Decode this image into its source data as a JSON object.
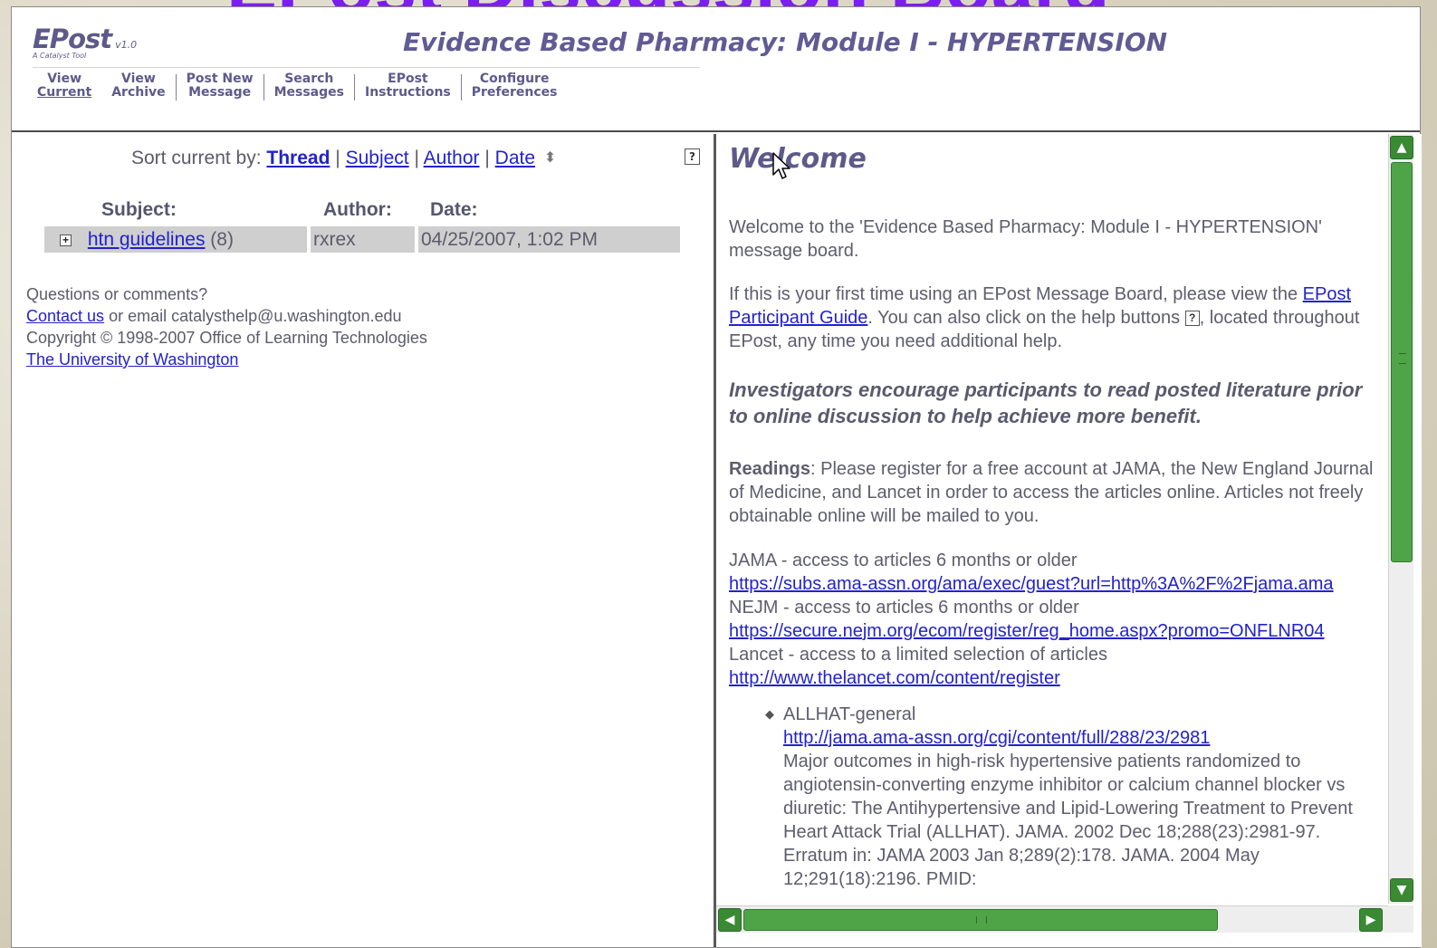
{
  "slide": {
    "title": "EPost Discussion Board",
    "title_color": "#7a1ff0"
  },
  "app": {
    "logo_name": "EPost",
    "logo_version": "v1.0",
    "logo_tagline": "A Catalyst Tool",
    "board_title": "Evidence Based Pharmacy: Module I - HYPERTENSION",
    "accent_color": "#5d5a8a"
  },
  "nav": {
    "items": [
      {
        "line1": "View",
        "line2": "Current",
        "active": true
      },
      {
        "line1": "View",
        "line2": "Archive"
      },
      {
        "line1": "Post New",
        "line2": "Message"
      },
      {
        "line1": "Search",
        "line2": "Messages"
      },
      {
        "line1": "EPost",
        "line2": "Instructions"
      },
      {
        "line1": "Configure",
        "line2": "Preferences"
      }
    ]
  },
  "sort": {
    "prefix": "Sort current by:",
    "options": [
      "Thread",
      "Subject",
      "Author",
      "Date"
    ],
    "selected": "Thread",
    "sep": "|",
    "help_label": "?"
  },
  "threads": {
    "columns": [
      "Subject:",
      "Author:",
      "Date:"
    ],
    "rows": [
      {
        "subject": "htn guidelines",
        "count": "(8)",
        "author": "rxrex",
        "date": "04/25/2007, 1:02 PM",
        "expand_icon": "plus-box-icon"
      }
    ]
  },
  "footer": {
    "question": "Questions or comments?",
    "contact_link": "Contact us",
    "email_text": "or email catalysthelp@u.washington.edu",
    "copyright": "Copyright © 1998-2007 Office of Learning Technologies",
    "university_link": "The University of Washington"
  },
  "welcome": {
    "title": "Welcome",
    "intro": "Welcome to the 'Evidence Based Pharmacy: Module I - HYPERTENSION' message board.",
    "first_time_a": "If this is your first time using an EPost Message Board, please view the",
    "guide_link": "EPost Participant Guide",
    "first_time_b": ". You can also click on the help buttons",
    "first_time_c": ", located throughout EPost, any time you need additional help.",
    "emphasis": "Investigators encourage participants to read posted literature prior to online discussion to help achieve more benefit.",
    "readings_label": "Readings",
    "readings_text": ": Please register for a free account at JAMA, the New England Journal of Medicine, and Lancet in order to access the articles online. Articles not freely obtainable online will be mailed to you.",
    "resources": [
      {
        "label": "JAMA - access to articles 6 months or older",
        "url": "https://subs.ama-assn.org/ama/exec/guest?url=http%3A%2F%2Fjama.ama"
      },
      {
        "label": "NEJM - access to articles 6 months or older",
        "url": "https://secure.nejm.org/ecom/register/reg_home.aspx?promo=ONFLNR04"
      },
      {
        "label": "Lancet - access to a limited selection of articles",
        "url": "http://www.thelancet.com/content/register"
      }
    ],
    "bullet": {
      "title": "ALLHAT-general",
      "url": "http://jama.ama-assn.org/cgi/content/full/288/23/2981",
      "citation": "Major outcomes in high-risk hypertensive patients randomized to angiotensin-converting enzyme inhibitor or calcium channel blocker vs diuretic: The Antihypertensive and Lipid-Lowering Treatment to Prevent Heart Attack Trial (ALLHAT). JAMA. 2002 Dec 18;288(23):2981-97. Erratum in: JAMA 2003 Jan 8;289(2):178. JAMA. 2004 May 12;291(18):2196. PMID:"
    }
  },
  "scrollbars": {
    "color": "#4fa447"
  }
}
